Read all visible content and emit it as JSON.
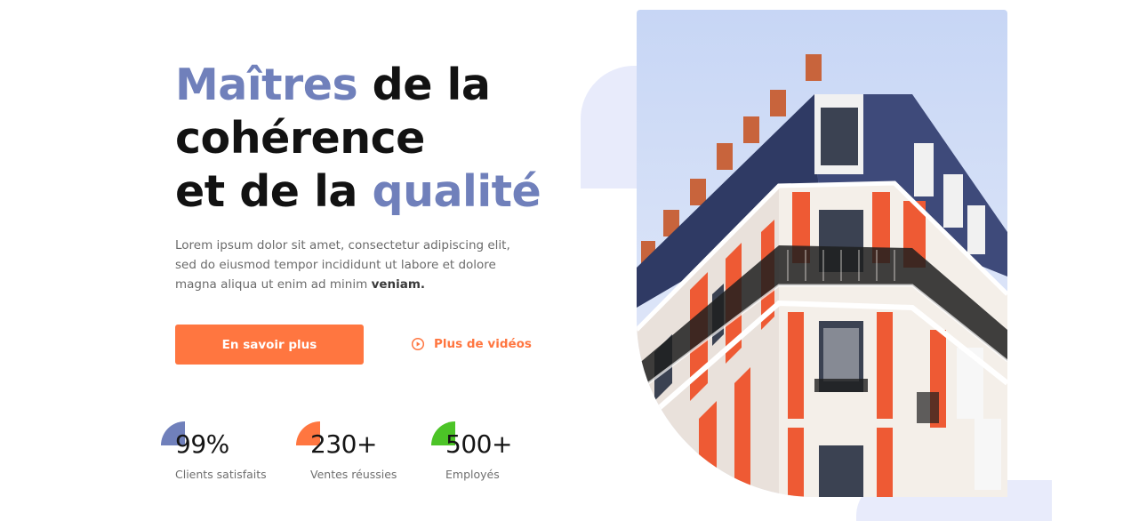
{
  "hero": {
    "title_line1_accent": "Maîtres",
    "title_line1_rest": " de la",
    "title_line2": "cohérence",
    "title_line3_pre": "et de la ",
    "title_line3_accent": "qualité",
    "lead_text": "Lorem ipsum dolor sit amet, consectetur adipiscing elit, sed do eiusmod tempor incididunt ut labore et dolore magna aliqua ut enim ad minim ",
    "lead_bold": "veniam.",
    "primary_button": "En savoir plus",
    "video_button": "Plus de vidéos"
  },
  "stats": [
    {
      "value": "99%",
      "label": "Clients satisfaits",
      "color": "#7080bb"
    },
    {
      "value": "230+",
      "label": "Ventes réussies",
      "color": "#ff7640"
    },
    {
      "value": "500+",
      "label": "Employés",
      "color": "#4cc427"
    }
  ],
  "colors": {
    "accent": "#7080bb",
    "orange": "#ff7640",
    "green": "#4cc427",
    "text": "#121212"
  },
  "icons": {
    "play": "play-circle-icon"
  }
}
